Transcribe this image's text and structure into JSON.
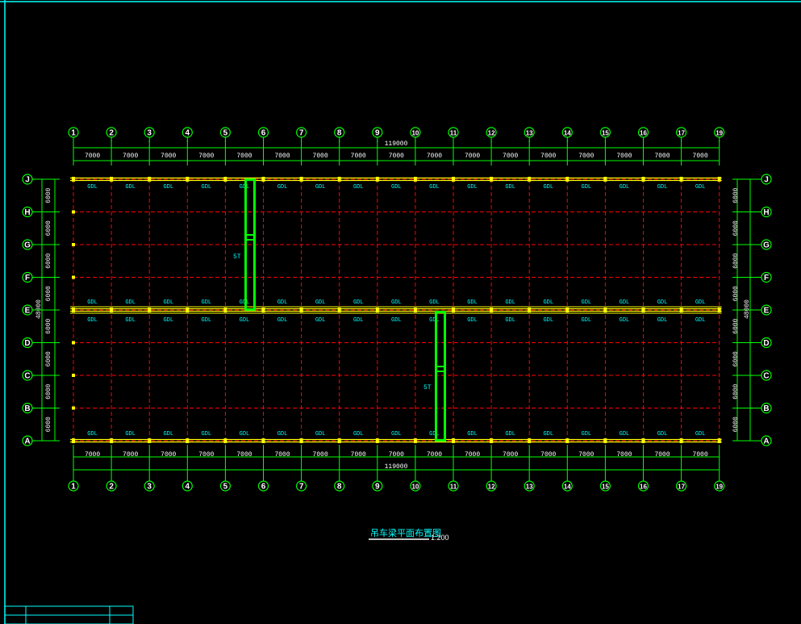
{
  "drawing": {
    "title": "吊车梁平面布置图",
    "scale": "1:200",
    "overall_length": "119000",
    "overall_width": "48000",
    "bay_spacing": "7000",
    "span_spacing": "6000",
    "beam_label": "GDL",
    "crane_label": "5T"
  },
  "grid_columns": [
    "1",
    "2",
    "3",
    "4",
    "5",
    "6",
    "7",
    "8",
    "9",
    "10",
    "11",
    "12",
    "13",
    "14",
    "15",
    "16",
    "17",
    "19"
  ],
  "grid_rows": [
    "J",
    "H",
    "G",
    "F",
    "E",
    "D",
    "C",
    "B",
    "A"
  ],
  "colors": {
    "background": "#000000",
    "frame": "#00ffff",
    "grid_line": "#ff0000",
    "axis_bubble": "#00ff00",
    "dimension": "#00ff00",
    "beam": "#ffff00",
    "crane": "#00ff00",
    "label": "#00ffff",
    "text": "#ffffff"
  }
}
